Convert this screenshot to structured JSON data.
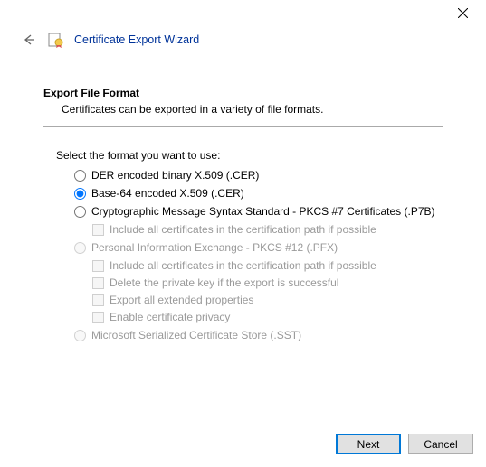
{
  "titlebar": {
    "close_label": "Close"
  },
  "header": {
    "title": "Certificate Export Wizard"
  },
  "section": {
    "heading": "Export File Format",
    "subtext": "Certificates can be exported in a variety of file formats."
  },
  "prompt": "Select the format you want to use:",
  "options": {
    "der": "DER encoded binary X.509 (.CER)",
    "base64": "Base-64 encoded X.509 (.CER)",
    "pkcs7": "Cryptographic Message Syntax Standard - PKCS #7 Certificates (.P7B)",
    "pkcs7_sub": {
      "include_path": "Include all certificates in the certification path if possible"
    },
    "pfx": "Personal Information Exchange - PKCS #12 (.PFX)",
    "pfx_sub": {
      "include_path": "Include all certificates in the certification path if possible",
      "delete_key": "Delete the private key if the export is successful",
      "export_ext": "Export all extended properties",
      "enable_privacy": "Enable certificate privacy"
    },
    "sst": "Microsoft Serialized Certificate Store (.SST)"
  },
  "buttons": {
    "next": "Next",
    "cancel": "Cancel"
  }
}
